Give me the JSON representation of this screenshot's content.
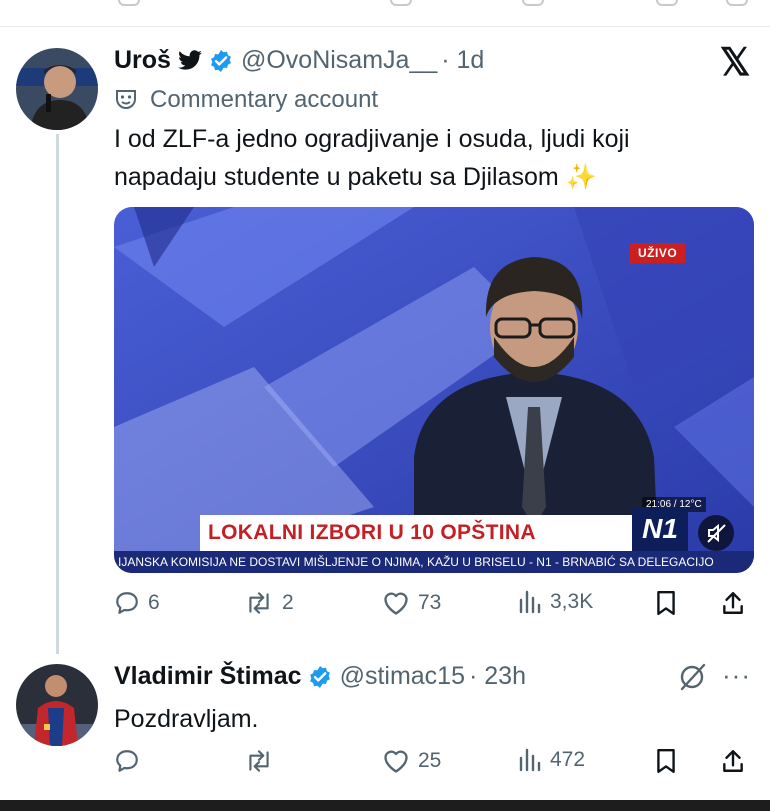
{
  "tweet1": {
    "author_name": "Uroš",
    "handle": "@OvoNisamJa__",
    "time": "· 1d",
    "community_label": "Commentary account",
    "text_line1": "I od ZLF-a jedno ogradjivanje i osuda, ljudi koji",
    "text_line2": "napadaju studente u paketu sa Djilasom",
    "sparkle": "✨",
    "media": {
      "live_badge": "UŽIVO",
      "time_temp": "21:06 / 12°C",
      "lower_third": "LOKALNI IZBORI U 10 OPŠTINA",
      "channel_logo": "N1",
      "ticker": "IJANSKA KOMISIJA NE DOSTAVI MIŠLJENJE O NJIMA, KAŽU U BRISELU - N1 - BRNABIĆ SA DELEGACIJO"
    },
    "actions": {
      "replies": "6",
      "reposts": "2",
      "likes": "73",
      "views": "3,3K"
    }
  },
  "tweet2": {
    "author_name": "Vladimir Štimac",
    "handle": "@stimac15",
    "time": "· 23h",
    "text": "Pozdravljam.",
    "more": "···",
    "actions": {
      "replies": "",
      "reposts": "",
      "likes": "25",
      "views": "472"
    }
  },
  "icons": {
    "x_logo": "𝕏",
    "colors": {
      "verified": "#1d9bf0",
      "text": "#0f1419",
      "muted": "#536471",
      "live": "#cc1f1f"
    }
  }
}
